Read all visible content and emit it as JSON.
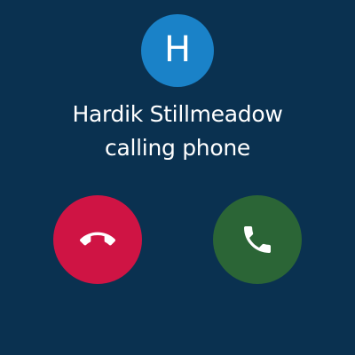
{
  "caller": {
    "initial": "H",
    "name": "Hardik Stillmeadow",
    "status": "calling phone"
  },
  "actions": {
    "decline_icon": "call-end-icon",
    "answer_icon": "phone-icon"
  },
  "colors": {
    "background": "#0a3150",
    "avatar": "#1a82c8",
    "decline": "#cf1444",
    "answer": "#2b6536",
    "text": "#ffffff"
  }
}
